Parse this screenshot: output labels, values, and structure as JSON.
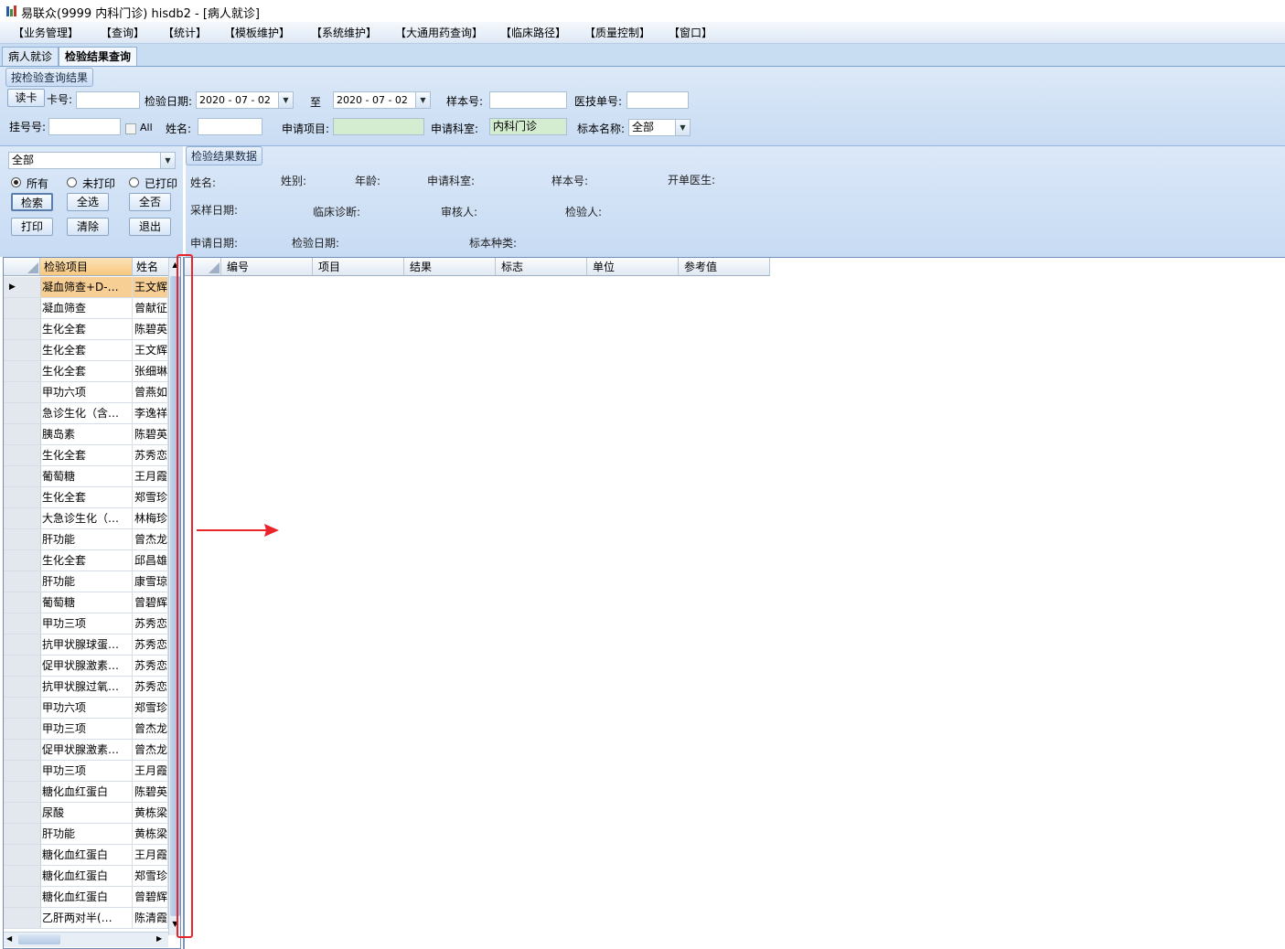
{
  "window": {
    "title": "易联众(9999 内科门诊) hisdb2 - [病人就诊]"
  },
  "menu": [
    "【业务管理】",
    "【查询】",
    "【统计】",
    "【模板维护】",
    "【系统维护】",
    "【大通用药查询】",
    "【临床路径】",
    "【质量控制】",
    "【窗口】"
  ],
  "tabs": [
    {
      "label": "病人就诊",
      "active": false
    },
    {
      "label": "检验结果查询",
      "active": true
    }
  ],
  "query": {
    "group_title": "按检验查询结果",
    "read_card": "读卡",
    "card_no_label": "卡号:",
    "card_no_value": "",
    "date_label": "检验日期:",
    "date_from": "2020 - 07 - 02",
    "to_label": "至",
    "date_to": "2020 - 07 - 02",
    "sample_no_label": "样本号:",
    "sample_no_value": "",
    "tech_no_label": "医技单号:",
    "tech_no_value": "",
    "reg_no_label": "挂号号:",
    "reg_no_value": "",
    "all_label": "All",
    "name_label": "姓名:",
    "name_value": "",
    "req_item_label": "申请项目:",
    "req_item_value": "",
    "req_dept_label": "申请科室:",
    "req_dept_value": "内科门诊",
    "specimen_label": "标本名称:",
    "specimen_value": "全部"
  },
  "filter": {
    "scope_value": "全部",
    "radios": [
      {
        "label": "所有",
        "checked": true
      },
      {
        "label": "未打印",
        "checked": false
      },
      {
        "label": "已打印",
        "checked": false
      }
    ],
    "buttons": {
      "search": "检索",
      "select_all": "全选",
      "deselect_all": "全否",
      "print": "打印",
      "clear": "清除",
      "exit": "退出"
    }
  },
  "result_header": {
    "group_title": "检验结果数据",
    "labels": {
      "name": "姓名:",
      "gender": "姓别:",
      "age": "年龄:",
      "req_dept": "申请科室:",
      "sample_no": "样本号:",
      "doctor": "开单医生:",
      "sample_date": "采样日期:",
      "diagnosis": "临床诊断:",
      "reviewer": "审核人:",
      "tester": "检验人:",
      "req_date": "申请日期:",
      "test_date": "检验日期:",
      "specimen_type": "标本种类:"
    }
  },
  "left_grid": {
    "columns": [
      "检验项目",
      "姓名"
    ],
    "rows": [
      [
        "凝血筛查+D-…",
        "王文辉"
      ],
      [
        "凝血筛查",
        "曾献征"
      ],
      [
        "生化全套",
        "陈碧英"
      ],
      [
        "生化全套",
        "王文辉"
      ],
      [
        "生化全套",
        "张细琳"
      ],
      [
        "甲功六项",
        "曾燕如"
      ],
      [
        "急诊生化（含…",
        "李逸祥"
      ],
      [
        "胰岛素",
        "陈碧英"
      ],
      [
        "生化全套",
        "苏秀恋"
      ],
      [
        "葡萄糖",
        "王月霞"
      ],
      [
        "生化全套",
        "郑雪珍"
      ],
      [
        "大急诊生化（…",
        "林梅珍"
      ],
      [
        "肝功能",
        "曾杰龙"
      ],
      [
        "生化全套",
        "邱昌雄"
      ],
      [
        "肝功能",
        "康雪琼"
      ],
      [
        "葡萄糖",
        "曾碧辉"
      ],
      [
        "甲功三项",
        "苏秀恋"
      ],
      [
        "抗甲状腺球蛋…",
        "苏秀恋"
      ],
      [
        "促甲状腺激素…",
        "苏秀恋"
      ],
      [
        "抗甲状腺过氧…",
        "苏秀恋"
      ],
      [
        "甲功六项",
        "郑雪珍"
      ],
      [
        "甲功三项",
        "曾杰龙"
      ],
      [
        "促甲状腺激素…",
        "曾杰龙"
      ],
      [
        "甲功三项",
        "王月霞"
      ],
      [
        "糖化血红蛋白",
        "陈碧英"
      ],
      [
        "尿酸",
        "黄栋梁"
      ],
      [
        "肝功能",
        "黄栋梁"
      ],
      [
        "糖化血红蛋白",
        "王月霞"
      ],
      [
        "糖化血红蛋白",
        "郑雪珍"
      ],
      [
        "糖化血红蛋白",
        "曾碧辉"
      ],
      [
        "乙肝两对半(…",
        "陈清霞"
      ]
    ]
  },
  "right_grid": {
    "columns": [
      "编号",
      "项目",
      "结果",
      "标志",
      "单位",
      "参考值"
    ]
  },
  "colors": {
    "selected_row": "#f7cf94",
    "annotation": "#e8252b",
    "panel": "#c9dcf3"
  }
}
